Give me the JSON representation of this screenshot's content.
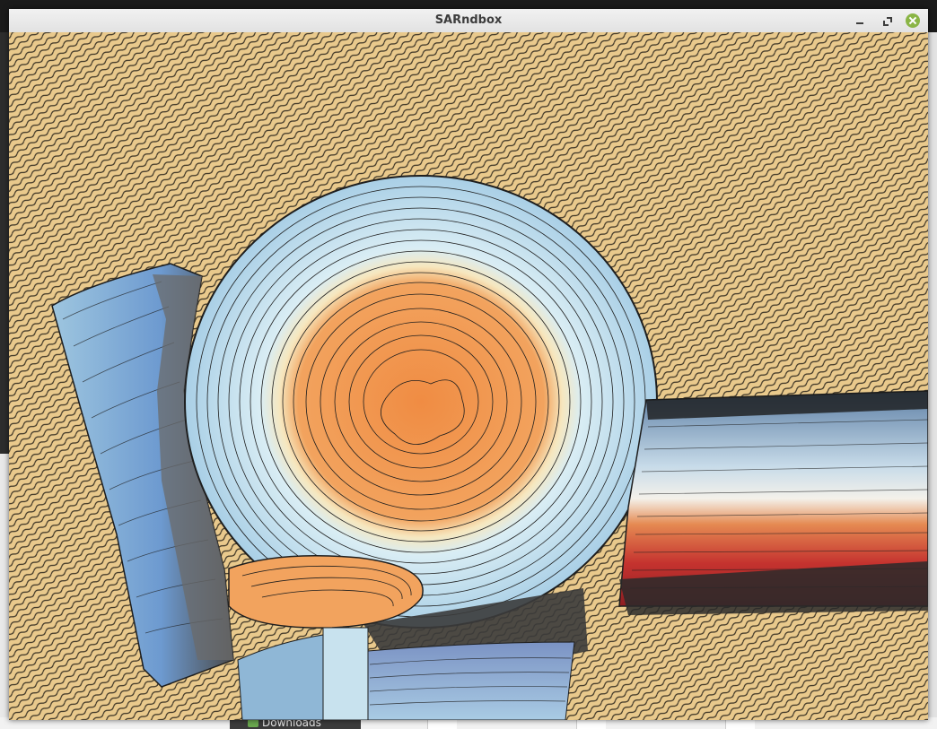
{
  "window": {
    "title": "SARndbox"
  },
  "taskbar": {
    "items": [
      {
        "label": "Downloads",
        "icon": "folder-icon"
      }
    ]
  },
  "colors": {
    "sand": "#e9c98c",
    "sand_texture": "#3a3224",
    "water_light": "#c8e2ee",
    "water_deep": "#6d9ad0",
    "peak_orange": "#ef9a4c",
    "ridge_red": "#b9272b",
    "contour": "#1e1e1e",
    "close_button": "#8ab545"
  }
}
